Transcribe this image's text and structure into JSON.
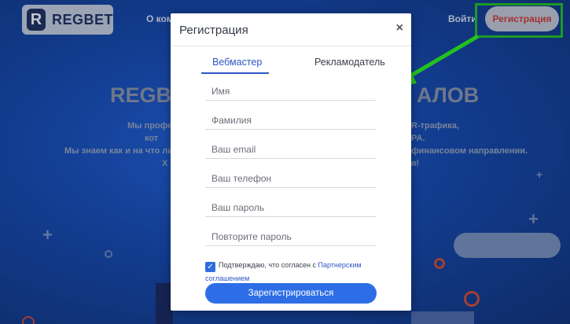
{
  "header": {
    "logo_mark": "R",
    "logo_text": "REGBET",
    "nav_partial": "О ком",
    "login": "Войти",
    "register": "Регистрация"
  },
  "hero": {
    "title_left": "REGBE",
    "title_right": "АЛОВ",
    "line1_left": "Мы профе",
    "line1_right": "R-трафика,",
    "line2_left": "кот",
    "line2_right": "PA.",
    "line3_left": "Мы знаем как и на что ли",
    "line3_right": "финансовом направлении.",
    "line4_left": "Х",
    "line4_right": "я!"
  },
  "modal": {
    "title": "Регистрация",
    "close": "×",
    "tabs": [
      {
        "label": "Вебмастер",
        "active": true
      },
      {
        "label": "Рекламодатель",
        "active": false
      }
    ],
    "fields": {
      "name": "Имя",
      "surname": "Фамилия",
      "email": "Ваш email",
      "phone": "Ваш телефон",
      "password": "Ваш пароль",
      "password_repeat": "Повторите пароль"
    },
    "agree_text": "Подтверждаю, что согласен с ",
    "agree_link": "Партнерским соглашением",
    "checkbox_checked": true,
    "submit": "Зарегистрироваться"
  },
  "colors": {
    "accent": "#2d6ee6",
    "highlight": "#22c21e",
    "register_text": "#d33a2c"
  },
  "icons": {
    "close": "close-icon",
    "check": "check-icon",
    "arrow": "green-arrow-icon"
  }
}
